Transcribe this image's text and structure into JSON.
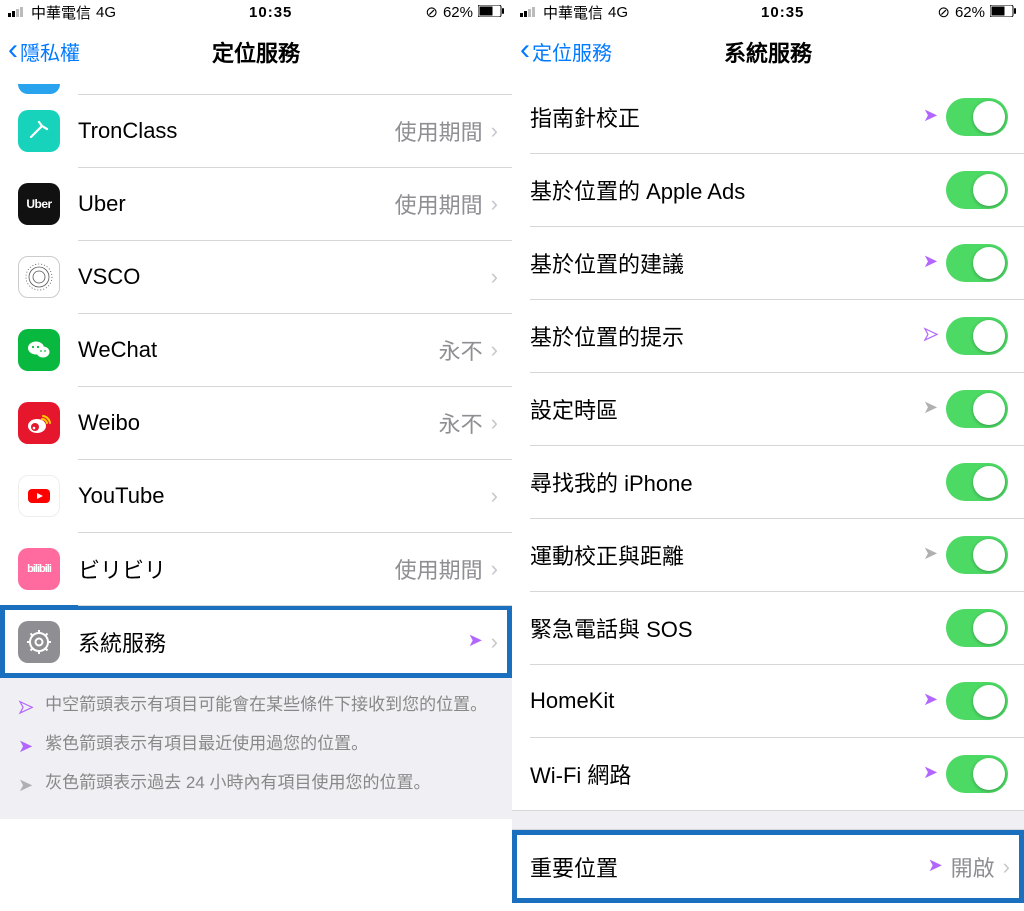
{
  "status": {
    "carrier": "中華電信",
    "network": "4G",
    "time": "10:35",
    "battery": "62%"
  },
  "left": {
    "back": "隱私權",
    "title": "定位服務",
    "rows": [
      {
        "name": "TronClass",
        "status": "使用期間",
        "icon": "tronclass"
      },
      {
        "name": "Uber",
        "status": "使用期間",
        "icon": "uber"
      },
      {
        "name": "VSCO",
        "status": "",
        "icon": "vsco"
      },
      {
        "name": "WeChat",
        "status": "永不",
        "icon": "wechat"
      },
      {
        "name": "Weibo",
        "status": "永不",
        "icon": "weibo"
      },
      {
        "name": "YouTube",
        "status": "",
        "icon": "youtube"
      },
      {
        "name": "ビリビリ",
        "status": "使用期間",
        "icon": "bilibili"
      },
      {
        "name": "系統服務",
        "status": "",
        "icon": "gear",
        "arrow": "purple"
      }
    ],
    "legend": {
      "l1": "中空箭頭表示有項目可能會在某些條件下接收到您的位置。",
      "l2": "紫色箭頭表示有項目最近使用過您的位置。",
      "l3": "灰色箭頭表示過去 24 小時內有項目使用您的位置。"
    }
  },
  "right": {
    "back": "定位服務",
    "title": "系統服務",
    "rows": [
      {
        "name": "指南針校正",
        "arrow": "purple"
      },
      {
        "name": "基於位置的 Apple Ads",
        "arrow": ""
      },
      {
        "name": "基於位置的建議",
        "arrow": "purple"
      },
      {
        "name": "基於位置的提示",
        "arrow": "hollow-purple"
      },
      {
        "name": "設定時區",
        "arrow": "gray"
      },
      {
        "name": "尋找我的 iPhone",
        "arrow": ""
      },
      {
        "name": "運動校正與距離",
        "arrow": "gray"
      },
      {
        "name": "緊急電話與 SOS",
        "arrow": ""
      },
      {
        "name": "HomeKit",
        "arrow": "purple"
      },
      {
        "name": "Wi-Fi 網路",
        "arrow": "purple"
      }
    ],
    "important": {
      "name": "重要位置",
      "status": "開啟",
      "arrow": "purple"
    }
  }
}
